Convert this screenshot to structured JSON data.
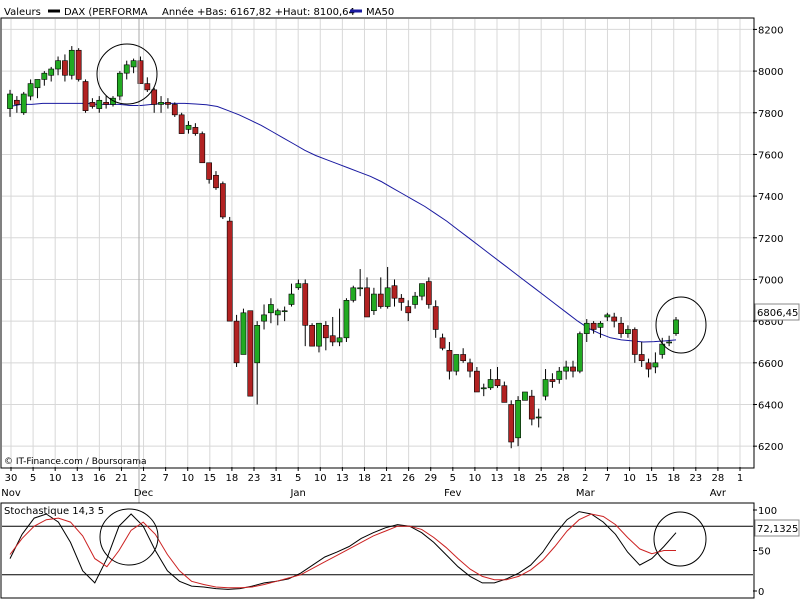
{
  "legend": {
    "valeurs": "Valeurs",
    "dax": "DAX (PERFORMA",
    "annee": "Année +Bas: 6167,82 +Haut: 8100,64",
    "ma50": "MA50"
  },
  "source_label": "© IT-Finance.com / Boursorama",
  "stoch_label": "Stochastique 14,3 5",
  "last_price": "6806,45",
  "last_stoch": "72,1325",
  "colors": {
    "up": "#22aa22",
    "down": "#b22222",
    "ma": "#1a1aa0",
    "stoch_k": "#000000",
    "stoch_d": "#cc2222",
    "grid": "#d8d8d8"
  },
  "chart_data": [
    {
      "type": "candlestick",
      "title": "DAX (PERFORMA",
      "ylim": [
        6100,
        8250
      ],
      "y_ticks": [
        6200,
        6400,
        6600,
        6800,
        7000,
        7200,
        7400,
        7600,
        7800,
        8000,
        8200
      ],
      "x_day_labels": [
        "30",
        "5",
        "10",
        "13",
        "16",
        "21",
        "2",
        "7",
        "10",
        "15",
        "18",
        "23",
        "31",
        "5",
        "10",
        "13",
        "18",
        "21",
        "26",
        "29",
        "5",
        "10",
        "13",
        "18",
        "25",
        "28",
        "2",
        "7",
        "10",
        "15",
        "18",
        "23",
        "28",
        "1"
      ],
      "x_month_labels": [
        "Nov",
        "Dec",
        "Jan",
        "Fev",
        "Mar",
        "Avr"
      ],
      "candles": [
        [
          7820,
          7910,
          7780,
          7890
        ],
        [
          7860,
          7880,
          7800,
          7840
        ],
        [
          7800,
          7900,
          7790,
          7890
        ],
        [
          7880,
          7960,
          7860,
          7940
        ],
        [
          7920,
          7960,
          7870,
          7960
        ],
        [
          7960,
          8000,
          7930,
          7990
        ],
        [
          7980,
          8020,
          7950,
          8010
        ],
        [
          8010,
          8070,
          7980,
          8050
        ],
        [
          8050,
          8080,
          7950,
          7980
        ],
        [
          7980,
          8120,
          7960,
          8100
        ],
        [
          8100,
          8110,
          7950,
          7960
        ],
        [
          7950,
          7960,
          7800,
          7810
        ],
        [
          7850,
          7870,
          7820,
          7830
        ],
        [
          7820,
          7880,
          7800,
          7860
        ],
        [
          7850,
          7880,
          7820,
          7840
        ],
        [
          7840,
          7880,
          7830,
          7870
        ],
        [
          7880,
          8000,
          7860,
          7990
        ],
        [
          7990,
          8050,
          7960,
          8030
        ],
        [
          8020,
          8060,
          7990,
          8050
        ],
        [
          8050,
          8070,
          7940,
          7940
        ],
        [
          7940,
          7970,
          7900,
          7910
        ],
        [
          7910,
          7920,
          7800,
          7840
        ],
        [
          7840,
          7880,
          7800,
          7850
        ],
        [
          7850,
          7870,
          7820,
          7840
        ],
        [
          7840,
          7850,
          7780,
          7790
        ],
        [
          7790,
          7800,
          7700,
          7700
        ],
        [
          7720,
          7760,
          7700,
          7740
        ],
        [
          7730,
          7750,
          7690,
          7700
        ],
        [
          7700,
          7710,
          7560,
          7560
        ],
        [
          7560,
          7500,
          7460,
          7480
        ],
        [
          7500,
          7520,
          7430,
          7440
        ],
        [
          7460,
          7470,
          7290,
          7300
        ],
        [
          7280,
          7300,
          6800,
          6800
        ],
        [
          6800,
          6830,
          6580,
          6600
        ],
        [
          6640,
          6860,
          6640,
          6840
        ],
        [
          6850,
          6850,
          6440,
          6440
        ],
        [
          6600,
          6800,
          6400,
          6780
        ],
        [
          6800,
          6880,
          6760,
          6830
        ],
        [
          6840,
          6910,
          6790,
          6880
        ],
        [
          6830,
          6860,
          6780,
          6850
        ],
        [
          6850,
          6870,
          6800,
          6850
        ],
        [
          6880,
          6980,
          6870,
          6930
        ],
        [
          6960,
          7000,
          6950,
          6980
        ],
        [
          6980,
          7000,
          6680,
          6780
        ],
        [
          6780,
          6790,
          6680,
          6680
        ],
        [
          6680,
          6790,
          6650,
          6790
        ],
        [
          6780,
          6800,
          6660,
          6720
        ],
        [
          6730,
          6820,
          6680,
          6700
        ],
        [
          6700,
          6860,
          6680,
          6720
        ],
        [
          6720,
          6910,
          6700,
          6900
        ],
        [
          6900,
          6970,
          6890,
          6960
        ],
        [
          6960,
          7050,
          6920,
          6960
        ],
        [
          6960,
          7010,
          6820,
          6820
        ],
        [
          6850,
          6960,
          6830,
          6930
        ],
        [
          6930,
          7010,
          6860,
          6870
        ],
        [
          6870,
          7060,
          6860,
          6960
        ],
        [
          6970,
          7000,
          6870,
          6910
        ],
        [
          6910,
          6930,
          6850,
          6890
        ],
        [
          6870,
          6900,
          6800,
          6840
        ],
        [
          6880,
          6940,
          6860,
          6920
        ],
        [
          6920,
          6980,
          6900,
          6980
        ],
        [
          6990,
          7010,
          6860,
          6880
        ],
        [
          6870,
          6900,
          6720,
          6760
        ],
        [
          6720,
          6740,
          6660,
          6670
        ],
        [
          6660,
          6700,
          6520,
          6560
        ],
        [
          6560,
          6640,
          6540,
          6640
        ],
        [
          6640,
          6670,
          6600,
          6610
        ],
        [
          6600,
          6620,
          6530,
          6560
        ],
        [
          6560,
          6580,
          6460,
          6460
        ],
        [
          6480,
          6500,
          6440,
          6480
        ],
        [
          6480,
          6570,
          6470,
          6520
        ],
        [
          6520,
          6580,
          6480,
          6490
        ],
        [
          6490,
          6510,
          6410,
          6410
        ],
        [
          6400,
          6420,
          6190,
          6220
        ],
        [
          6240,
          6440,
          6200,
          6420
        ],
        [
          6420,
          6460,
          6420,
          6460
        ],
        [
          6440,
          6470,
          6300,
          6330
        ],
        [
          6340,
          6380,
          6290,
          6340
        ],
        [
          6440,
          6570,
          6420,
          6520
        ],
        [
          6520,
          6550,
          6480,
          6510
        ],
        [
          6520,
          6580,
          6500,
          6560
        ],
        [
          6560,
          6610,
          6520,
          6580
        ],
        [
          6580,
          6610,
          6530,
          6560
        ],
        [
          6560,
          6750,
          6550,
          6740
        ],
        [
          6740,
          6810,
          6700,
          6790
        ],
        [
          6790,
          6800,
          6740,
          6760
        ],
        [
          6770,
          6800,
          6720,
          6790
        ],
        [
          6820,
          6840,
          6800,
          6830
        ],
        [
          6820,
          6840,
          6770,
          6800
        ],
        [
          6790,
          6820,
          6720,
          6740
        ],
        [
          6740,
          6780,
          6720,
          6760
        ],
        [
          6760,
          6770,
          6600,
          6640
        ],
        [
          6640,
          6700,
          6580,
          6610
        ],
        [
          6600,
          6620,
          6530,
          6570
        ],
        [
          6580,
          6650,
          6550,
          6600
        ],
        [
          6640,
          6720,
          6620,
          6690
        ],
        [
          6700,
          6730,
          6680,
          6700
        ],
        [
          6740,
          6820,
          6730,
          6806
        ]
      ],
      "ma_points": [
        7830,
        7840,
        7840,
        7845,
        7845,
        7845,
        7845,
        7845,
        7840,
        7840,
        7840,
        7835,
        7835,
        7840,
        7845,
        7845,
        7845,
        7842,
        7838,
        7830,
        7810,
        7790,
        7765,
        7740,
        7710,
        7680,
        7650,
        7620,
        7595,
        7575,
        7555,
        7535,
        7515,
        7495,
        7470,
        7440,
        7410,
        7380,
        7350,
        7315,
        7280,
        7240,
        7200,
        7160,
        7120,
        7080,
        7040,
        7000,
        6960,
        6920,
        6880,
        6840,
        6800,
        6765,
        6740,
        6720,
        6710,
        6705,
        6700,
        6702,
        6705,
        6710
      ]
    },
    {
      "type": "line",
      "title": "Stochastique 14,3 5",
      "ylim": [
        0,
        100
      ],
      "y_ticks": [
        0,
        50,
        100
      ],
      "series": [
        {
          "name": "k",
          "values": [
            40,
            70,
            90,
            95,
            85,
            60,
            25,
            10,
            40,
            80,
            95,
            80,
            50,
            25,
            12,
            6,
            5,
            3,
            2,
            3,
            6,
            10,
            12,
            15,
            22,
            32,
            42,
            48,
            55,
            65,
            72,
            78,
            82,
            80,
            72,
            60,
            45,
            30,
            18,
            10,
            10,
            15,
            22,
            32,
            48,
            70,
            88,
            98,
            95,
            85,
            70,
            48,
            32,
            40,
            55,
            72
          ]
        },
        {
          "name": "d",
          "values": [
            45,
            65,
            80,
            88,
            90,
            85,
            68,
            40,
            30,
            50,
            75,
            85,
            70,
            45,
            25,
            12,
            8,
            5,
            4,
            4,
            5,
            8,
            12,
            16,
            20,
            28,
            36,
            44,
            52,
            60,
            68,
            74,
            80,
            80,
            76,
            66,
            54,
            40,
            27,
            18,
            14,
            14,
            18,
            26,
            38,
            55,
            74,
            88,
            95,
            92,
            82,
            66,
            52,
            46,
            50,
            50
          ]
        }
      ]
    }
  ]
}
